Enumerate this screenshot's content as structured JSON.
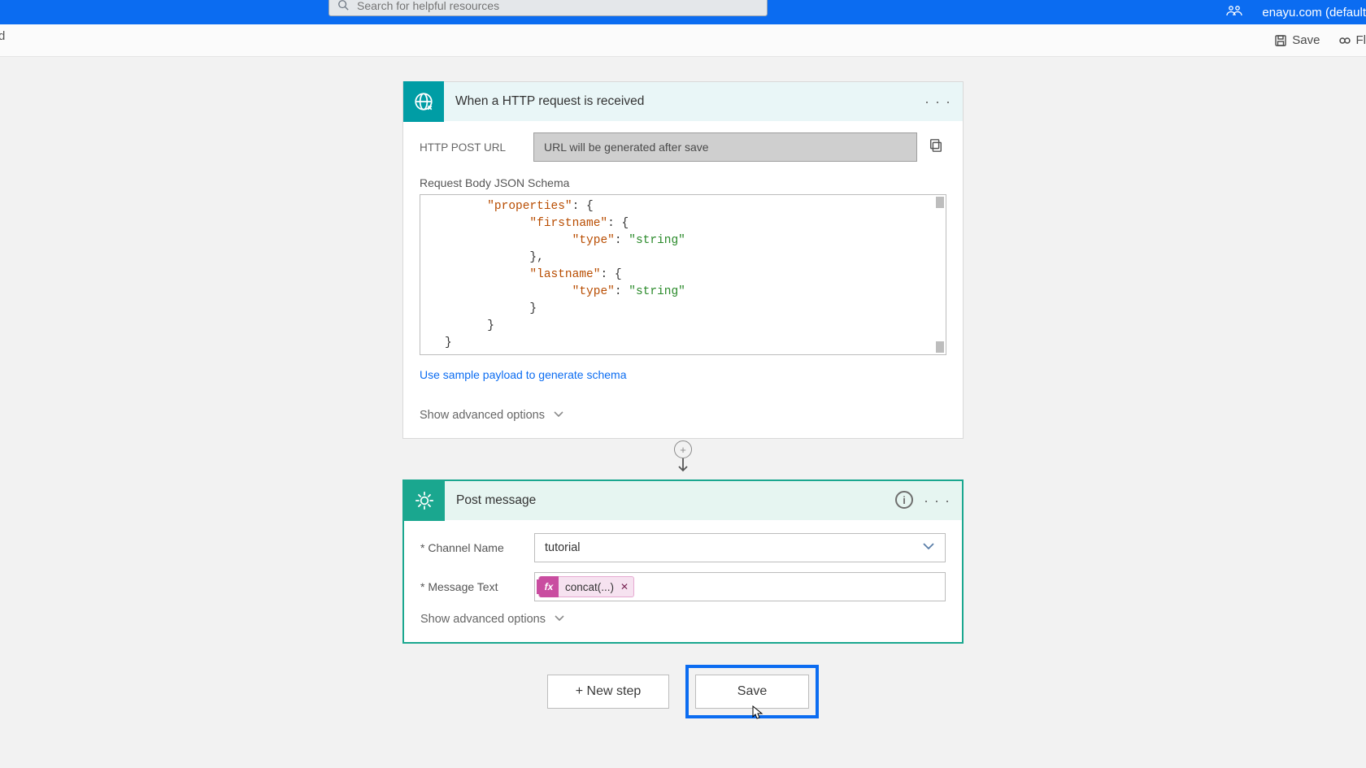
{
  "header": {
    "search_placeholder": "Search for helpful resources",
    "org_label": "enayu.com (default"
  },
  "crumb_fragment": "d",
  "toolbar": {
    "save_label": "Save",
    "flow_fragment": "Fl"
  },
  "http_card": {
    "title": "When a HTTP request is received",
    "url_label": "HTTP POST URL",
    "url_placeholder": "URL will be generated after save",
    "schema_label": "Request Body JSON Schema",
    "schema_lines": [
      {
        "indent": 2,
        "parts": [
          [
            "prop",
            "\"properties\""
          ],
          [
            "pun",
            ": {"
          ]
        ]
      },
      {
        "indent": 4,
        "parts": [
          [
            "prop",
            "\"firstname\""
          ],
          [
            "pun",
            ": {"
          ]
        ]
      },
      {
        "indent": 6,
        "parts": [
          [
            "prop",
            "\"type\""
          ],
          [
            "pun",
            ": "
          ],
          [
            "str",
            "\"string\""
          ]
        ]
      },
      {
        "indent": 4,
        "parts": [
          [
            "pun",
            "},"
          ]
        ]
      },
      {
        "indent": 4,
        "parts": [
          [
            "prop",
            "\"lastname\""
          ],
          [
            "pun",
            ": {"
          ]
        ]
      },
      {
        "indent": 6,
        "parts": [
          [
            "prop",
            "\"type\""
          ],
          [
            "pun",
            ": "
          ],
          [
            "str",
            "\"string\""
          ]
        ]
      },
      {
        "indent": 4,
        "parts": [
          [
            "pun",
            "}"
          ]
        ]
      },
      {
        "indent": 2,
        "parts": [
          [
            "pun",
            "}"
          ]
        ]
      },
      {
        "indent": 0,
        "parts": [
          [
            "pun",
            "}"
          ]
        ]
      }
    ],
    "sample_link": "Use sample payload to generate schema",
    "advanced_label": "Show advanced options"
  },
  "slack_card": {
    "title": "Post message",
    "channel_label": "Channel Name",
    "channel_value": "tutorial",
    "message_label": "Message Text",
    "token_fx": "fx",
    "token_text": "concat(...)",
    "advanced_label": "Show advanced options"
  },
  "buttons": {
    "new_step": "+ New step",
    "save": "Save"
  }
}
